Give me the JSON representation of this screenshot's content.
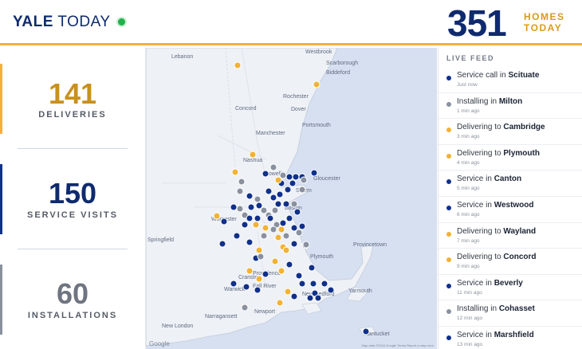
{
  "header": {
    "brand_bold": "YALE",
    "brand_light": "TODAY",
    "headline_number": "351",
    "headline_label_1": "HOMES",
    "headline_label_2": "TODAY",
    "colors": {
      "navy": "#0f2a6e",
      "gold": "#f2b233",
      "live": "#1fb14c"
    }
  },
  "stats": [
    {
      "value": "141",
      "label": "DELIVERIES",
      "color": "#c9911b",
      "accent": "#f2b233"
    },
    {
      "value": "150",
      "label": "SERVICE VISITS",
      "color": "#0f2a6e",
      "accent": "#10308a"
    },
    {
      "value": "60",
      "label": "INSTALLATIONS",
      "color": "#6e7480",
      "accent": "#8a919e"
    }
  ],
  "map": {
    "places": [
      "Lebanon",
      "Westbrook",
      "Scarborough",
      "Biddeford",
      "Rochester",
      "Dover",
      "Concord",
      "Portsmouth",
      "Manchester",
      "Nashua",
      "Lowell",
      "Salem",
      "Gloucester",
      "Boston",
      "Worcester",
      "Springfield",
      "Plymouth",
      "Provincetown",
      "Providence",
      "Cranston",
      "Fall River",
      "New Bedford",
      "Yarmouth",
      "Warwick",
      "Narragansett",
      "Newport",
      "New London",
      "Nantucket"
    ],
    "google_label": "Google",
    "attribution": "Map data ©2024 Google   Terms   Report a map error"
  },
  "feed": {
    "title": "LIVE FEED",
    "items": [
      {
        "action": "Service call in",
        "location": "Scituate",
        "time": "Just now",
        "type": "service"
      },
      {
        "action": "Installing in",
        "location": "Milton",
        "time": "1 min ago",
        "type": "install"
      },
      {
        "action": "Delivering to",
        "location": "Cambridge",
        "time": "3 min ago",
        "type": "delivery"
      },
      {
        "action": "Delivering to",
        "location": "Plymouth",
        "time": "4 min ago",
        "type": "delivery"
      },
      {
        "action": "Service in",
        "location": "Canton",
        "time": "5 min ago",
        "type": "service"
      },
      {
        "action": "Service in",
        "location": "Westwood",
        "time": "6 min ago",
        "type": "service"
      },
      {
        "action": "Delivering to",
        "location": "Wayland",
        "time": "7 min ago",
        "type": "delivery"
      },
      {
        "action": "Delivering to",
        "location": "Concord",
        "time": "9 min ago",
        "type": "delivery"
      },
      {
        "action": "Service in",
        "location": "Beverly",
        "time": "11 min ago",
        "type": "service"
      },
      {
        "action": "Installing in",
        "location": "Cohasset",
        "time": "12 min ago",
        "type": "install"
      },
      {
        "action": "Service in",
        "location": "Marshfield",
        "time": "13 min ago",
        "type": "service"
      }
    ],
    "type_colors": {
      "service": "#10308a",
      "install": "#8a919e",
      "delivery": "#f2b233"
    }
  }
}
